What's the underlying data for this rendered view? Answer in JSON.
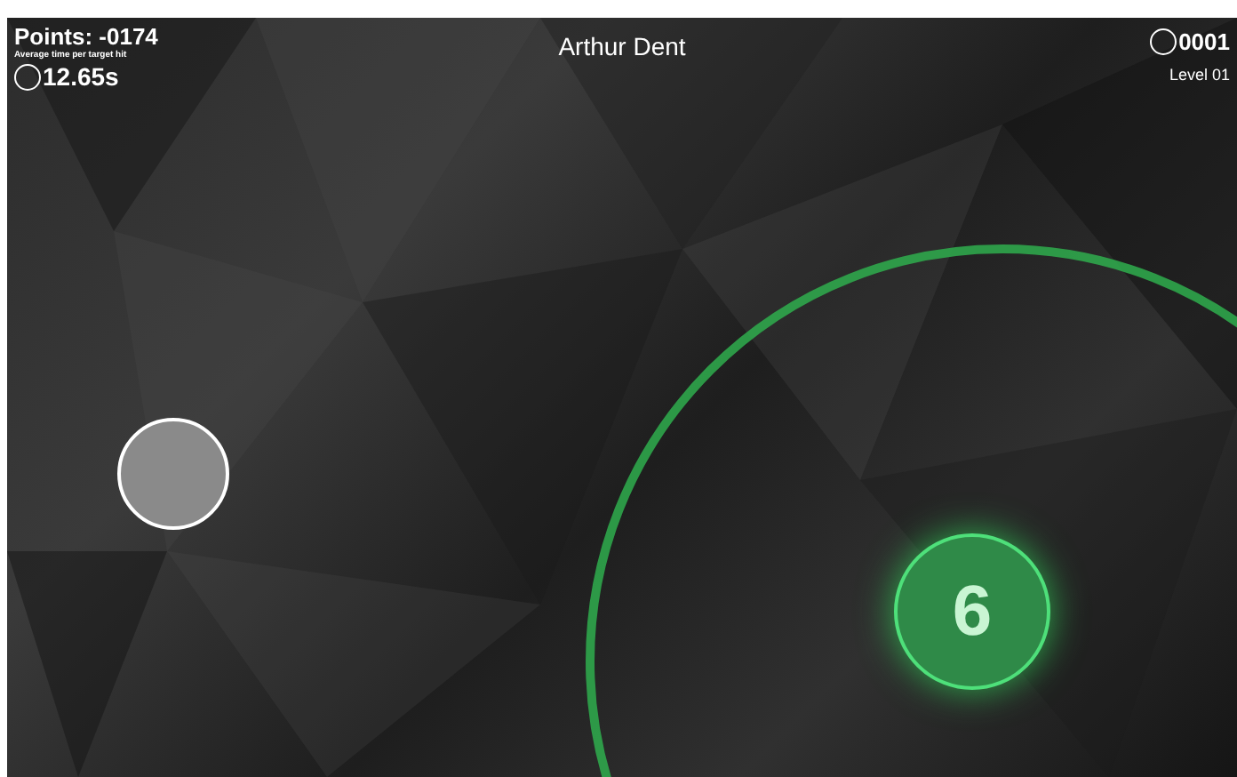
{
  "hud": {
    "points": "Points: -0174",
    "average_label": "Average time per target hit",
    "average_time": "12.65s",
    "player": "Arthur Dent",
    "hits": "0001",
    "level": "Level 01"
  },
  "target": {
    "number": "6"
  }
}
